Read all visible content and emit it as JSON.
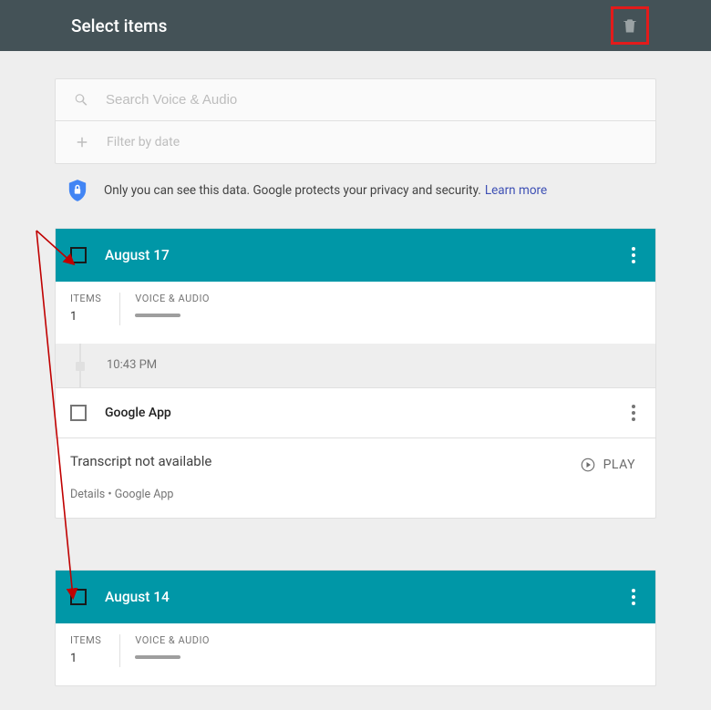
{
  "header": {
    "title": "Select items"
  },
  "search": {
    "placeholder": "Search Voice & Audio",
    "filterLabel": "Filter by date"
  },
  "privacy": {
    "text": "Only you can see this data. Google protects your privacy and security.",
    "linkLabel": "Learn more"
  },
  "days": [
    {
      "date": "August 17",
      "itemsLabel": "ITEMS",
      "itemsCount": "1",
      "audioLabel": "VOICE & AUDIO",
      "entries": [
        {
          "time": "10:43 PM",
          "title": "Google App",
          "transcript": "Transcript not available",
          "playLabel": "PLAY",
          "detailsLabel": "Details",
          "sourceLabel": "Google App"
        }
      ]
    },
    {
      "date": "August 14",
      "itemsLabel": "ITEMS",
      "itemsCount": "1",
      "audioLabel": "VOICE & AUDIO"
    }
  ]
}
